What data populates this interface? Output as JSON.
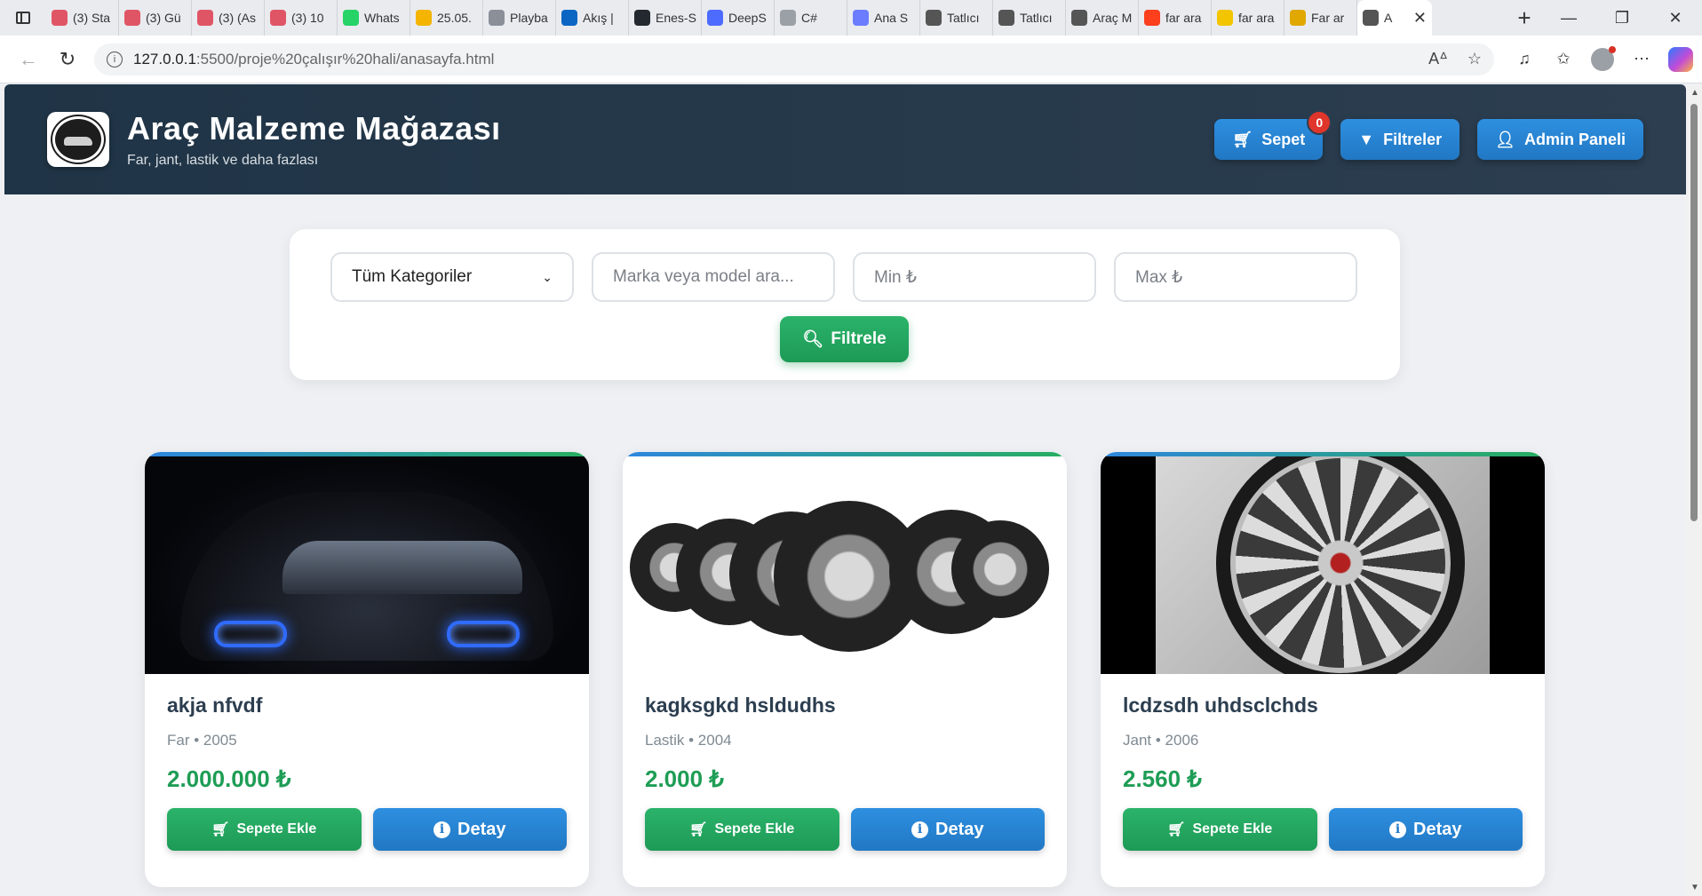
{
  "browser": {
    "tabs": [
      {
        "label": "(3) Sta",
        "icon": "youtube-icon",
        "color": "#e05565"
      },
      {
        "label": "(3) Gü",
        "icon": "youtube-icon",
        "color": "#e05565"
      },
      {
        "label": "(3) (As",
        "icon": "youtube-icon",
        "color": "#e05565"
      },
      {
        "label": "(3) 10",
        "icon": "youtube-icon",
        "color": "#e05565"
      },
      {
        "label": "Whats",
        "icon": "whatsapp-icon",
        "color": "#25d366"
      },
      {
        "label": "25.05.",
        "icon": "drive-icon",
        "color": "#f4b400"
      },
      {
        "label": "Playba",
        "icon": "bing-icon",
        "color": "#8a8f98"
      },
      {
        "label": "Akış |",
        "icon": "linkedin-icon",
        "color": "#0a66c2"
      },
      {
        "label": "Enes-S",
        "icon": "github-icon",
        "color": "#24292f"
      },
      {
        "label": "DeepS",
        "icon": "deepseek-icon",
        "color": "#4d6bfe"
      },
      {
        "label": "C#",
        "icon": "generic-icon",
        "color": "#9aa0a6"
      },
      {
        "label": "Ana S",
        "icon": "generic-icon",
        "color": "#6b7cff"
      },
      {
        "label": "Tatlıcı",
        "icon": "openai-icon",
        "color": "#555555"
      },
      {
        "label": "Tatlıcı",
        "icon": "openai-icon",
        "color": "#555555"
      },
      {
        "label": "Araç M",
        "icon": "globe-icon",
        "color": "#555555"
      },
      {
        "label": "far ara",
        "icon": "yandex-icon",
        "color": "#fc3f1d"
      },
      {
        "label": "far ara",
        "icon": "play-icon",
        "color": "#f2c500"
      },
      {
        "label": "Far ar",
        "icon": "image-icon",
        "color": "#e0a800"
      },
      {
        "label": "A",
        "icon": "globe-icon",
        "color": "#555555",
        "active": true
      }
    ],
    "url_host": "127.0.0.1",
    "url_path": ":5500/proje%20çalışır%20hali/anasayfa.html"
  },
  "header": {
    "title": "Araç Malzeme Mağazası",
    "subtitle": "Far, jant, lastik ve daha fazlası",
    "cart_label": "Sepet",
    "cart_count": "0",
    "filters_label": "Filtreler",
    "admin_label": "Admin Paneli"
  },
  "filters": {
    "category_value": "Tüm Kategoriler",
    "search_placeholder": "Marka veya model ara...",
    "min_placeholder": "Min ₺",
    "max_placeholder": "Max ₺",
    "submit_label": "Filtrele"
  },
  "products": [
    {
      "name": "akja nfvdf",
      "meta": "Far • 2005",
      "price": "2.000.000 ₺",
      "add_label": "Sepete Ekle",
      "detail_label": "Detay"
    },
    {
      "name": "kagksgkd hsldudhs",
      "meta": "Lastik • 2004",
      "price": "2.000 ₺",
      "add_label": "Sepete Ekle",
      "detail_label": "Detay"
    },
    {
      "name": "lcdzsdh uhdsclchds",
      "meta": "Jant • 2006",
      "price": "2.560 ₺",
      "add_label": "Sepete Ekle",
      "detail_label": "Detay"
    }
  ],
  "colors": {
    "header_bg": "#2c3e50",
    "primary_blue": "#2178c4",
    "success_green": "#1d9a56",
    "price_green": "#1e9d55",
    "badge_red": "#e0352b"
  }
}
